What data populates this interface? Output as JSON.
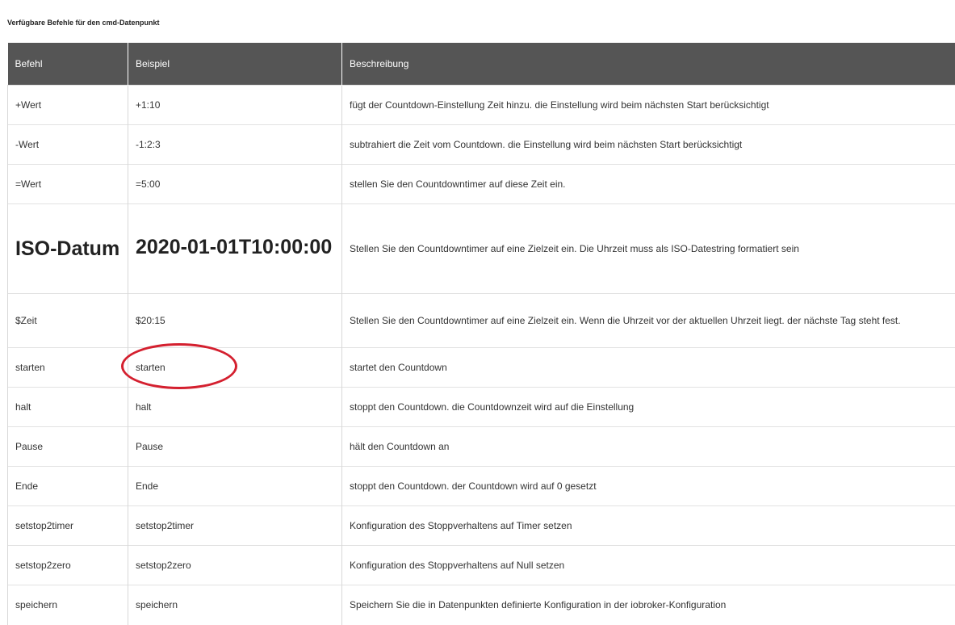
{
  "heading": "Verfügbare Befehle für den cmd-Datenpunkt",
  "table": {
    "headers": [
      "Befehl",
      "Beispiel",
      "Beschreibung"
    ],
    "rows": [
      {
        "cmd": "+Wert",
        "example": "+1:10",
        "desc": "fügt der Countdown-Einstellung Zeit hinzu. die Einstellung wird beim nächsten Start berücksichtigt"
      },
      {
        "cmd": "-Wert",
        "example": "-1:2:3",
        "desc": "subtrahiert die Zeit vom Countdown. die Einstellung wird beim nächsten Start berücksichtigt"
      },
      {
        "cmd": "=Wert",
        "example": "=5:00",
        "desc": "stellen Sie den Countdowntimer auf diese Zeit ein."
      },
      {
        "cmd": "ISO-Datum",
        "example": "2020-01-01T10:00:00",
        "desc": "Stellen Sie den Countdowntimer auf eine Zielzeit ein. Die Uhrzeit muss als ISO-Datestring formatiert sein"
      },
      {
        "cmd": "$Zeit",
        "example": "$20:15",
        "desc": "Stellen Sie den Countdowntimer auf eine Zielzeit ein. Wenn die Uhrzeit vor der aktuellen Uhrzeit liegt. der nächste Tag steht fest."
      },
      {
        "cmd": "starten",
        "example": "starten",
        "desc": "startet den Countdown"
      },
      {
        "cmd": "halt",
        "example": "halt",
        "desc": "stoppt den Countdown. die Countdownzeit wird auf die Einstellung"
      },
      {
        "cmd": "Pause",
        "example": "Pause",
        "desc": "hält den Countdown an"
      },
      {
        "cmd": "Ende",
        "example": "Ende",
        "desc": "stoppt den Countdown. der Countdown wird auf 0 gesetzt"
      },
      {
        "cmd": "setstop2timer",
        "example": "setstop2timer",
        "desc": "Konfiguration des Stoppverhaltens auf Timer setzen"
      },
      {
        "cmd": "setstop2zero",
        "example": "setstop2zero",
        "desc": "Konfiguration des Stoppverhaltens auf Null setzen"
      },
      {
        "cmd": "speichern",
        "example": "speichern",
        "desc": "Speichern Sie die in Datenpunkten definierte Konfiguration in der iobroker-Konfiguration"
      }
    ]
  },
  "colors": {
    "header_bg": "#555555",
    "header_text": "#ffffff",
    "annotation": "#d4202f"
  },
  "annotation": {
    "type": "ellipse-highlight",
    "target": "starten"
  }
}
